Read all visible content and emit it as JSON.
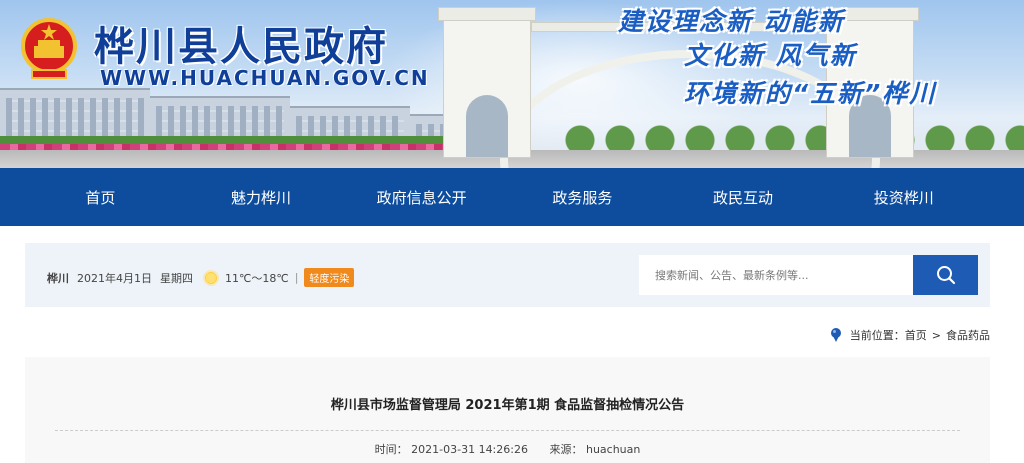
{
  "banner": {
    "site_title": "桦川县人民政府",
    "site_url": "WWW.HUACHUAN.GOV.CN",
    "slogans": [
      "建设理念新 动能新",
      "文化新 风气新",
      "环境新的“五新”桦川"
    ]
  },
  "nav": {
    "items": [
      {
        "label": "首页"
      },
      {
        "label": "魅力桦川"
      },
      {
        "label": "政府信息公开"
      },
      {
        "label": "政务服务"
      },
      {
        "label": "政民互动"
      },
      {
        "label": "投资桦川"
      }
    ]
  },
  "infobar": {
    "location": "桦川",
    "date": "2021年4月1日",
    "weekday": "星期四",
    "temperature": "11℃～18℃",
    "separator": "|",
    "pollution": "轻度污染"
  },
  "search": {
    "placeholder": "搜索新闻、公告、最新条例等..."
  },
  "breadcrumb": {
    "prefix": "当前位置：",
    "items": [
      "首页",
      "食品药品"
    ],
    "separator": ">"
  },
  "article": {
    "title": "桦川县市场监督管理局 2021年第1期 食品监督抽检情况公告",
    "time_label": "时间：",
    "time_value": "2021-03-31 14:26:26",
    "source_label": "来源：",
    "source_value": "huachuan"
  },
  "colors": {
    "nav_bg": "#0e4d9d",
    "search_button": "#1e5bb5",
    "badge": "#f08a1c",
    "title_blue": "#0f3f98"
  },
  "icons": [
    "national-emblem-icon",
    "sun-icon",
    "search-icon",
    "location-pin-icon"
  ]
}
